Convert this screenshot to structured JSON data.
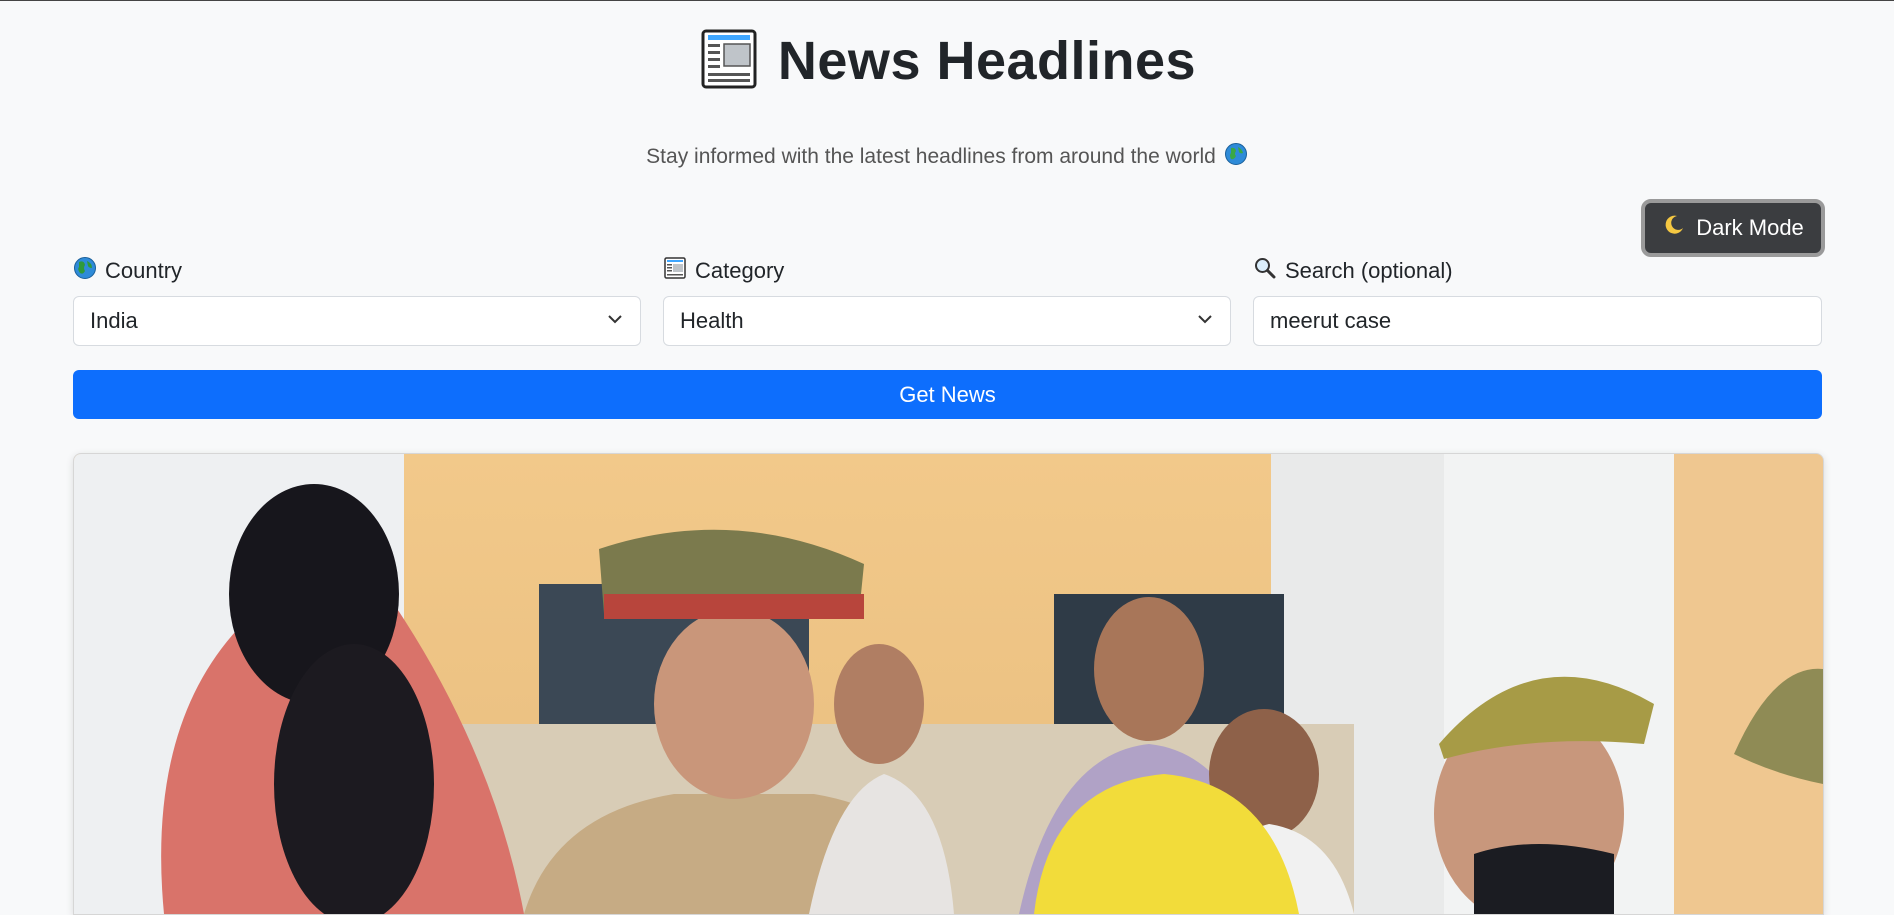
{
  "header": {
    "title": "News Headlines",
    "icon": "newspaper-icon",
    "subtitle": "Stay informed with the latest headlines from around the world",
    "subtitle_icon": "globe-icon"
  },
  "theme_toggle": {
    "label": "Dark Mode",
    "icon": "moon-icon"
  },
  "filters": {
    "country": {
      "label": "Country",
      "icon": "globe-icon",
      "value": "India"
    },
    "category": {
      "label": "Category",
      "icon": "newspaper-icon",
      "value": "Health"
    },
    "search": {
      "label": "Search (optional)",
      "icon": "magnifier-icon",
      "value": "meerut case"
    }
  },
  "submit": {
    "label": "Get News",
    "color": "#0d6efd"
  },
  "colors": {
    "background": "#f8f9fa",
    "accent": "#0d6efd",
    "dark_button": "#3b3d40"
  }
}
